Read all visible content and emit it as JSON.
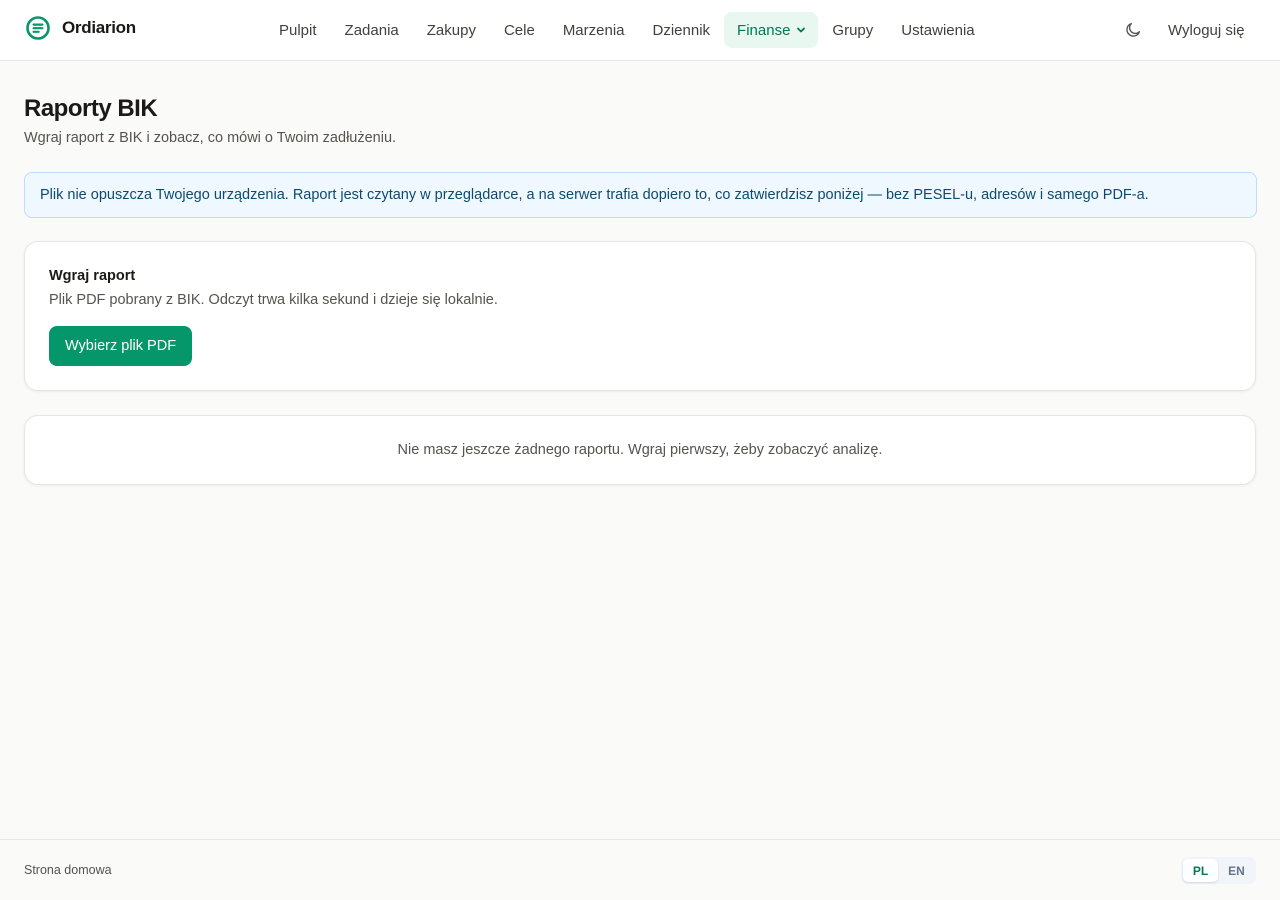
{
  "app": {
    "name": "Ordiarion",
    "logo_icon": "ordiarion-logo-icon",
    "accent_color": "#059669"
  },
  "nav": {
    "items": [
      {
        "label": "Pulpit"
      },
      {
        "label": "Zadania"
      },
      {
        "label": "Zakupy"
      },
      {
        "label": "Cele"
      },
      {
        "label": "Marzenia"
      },
      {
        "label": "Dziennik"
      },
      {
        "label": "Finanse",
        "active": true,
        "has_dropdown": true
      },
      {
        "label": "Grupy"
      },
      {
        "label": "Ustawienia"
      }
    ],
    "theme_toggle_icon": "moon-icon",
    "logout_label": "Wyloguj się"
  },
  "page": {
    "title": "Raporty BIK",
    "subtitle": "Wgraj raport z BIK i zobacz, co mówi o Twoim zadłużeniu."
  },
  "notice": {
    "text": "Plik nie opuszcza Twojego urządzenia. Raport jest czytany w przeglądarce, a na serwer trafia dopiero to, co zatwierdzisz poniżej — bez PESEL-u, adresów i samego PDF-a."
  },
  "upload": {
    "title": "Wgraj raport",
    "description": "Plik PDF pobrany z BIK. Odczyt trwa kilka sekund i dzieje się lokalnie.",
    "button_label": "Wybierz plik PDF"
  },
  "empty_state": {
    "text": "Nie masz jeszcze żadnego raportu. Wgraj pierwszy, żeby zobaczyć analizę."
  },
  "footer": {
    "home_link": "Strona domowa",
    "languages": [
      {
        "code": "PL",
        "active": true
      },
      {
        "code": "EN",
        "active": false
      }
    ]
  }
}
